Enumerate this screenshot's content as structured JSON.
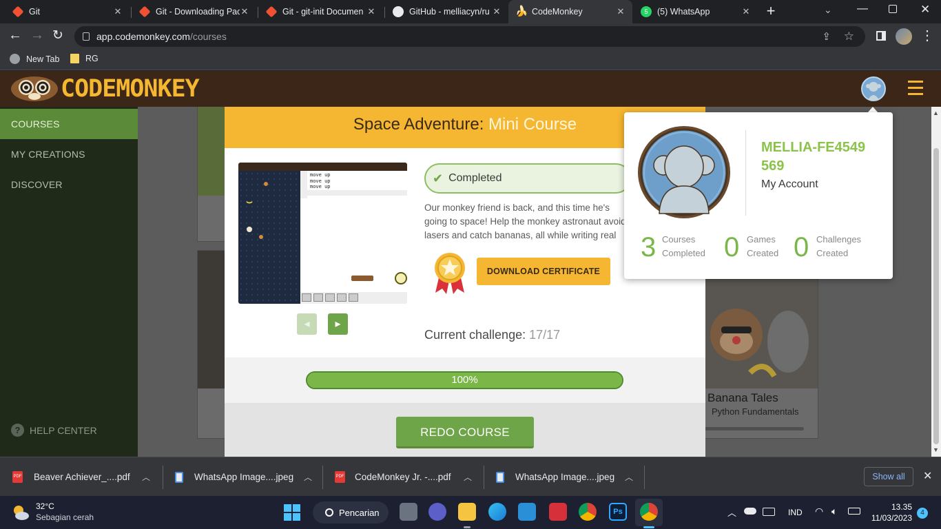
{
  "browser": {
    "tabs": [
      {
        "title": "Git",
        "active": false
      },
      {
        "title": "Git - Downloading Pac",
        "active": false
      },
      {
        "title": "Git - git-init Documen",
        "active": false
      },
      {
        "title": "GitHub - melliacyn/ru",
        "active": false
      },
      {
        "title": "CodeMonkey",
        "active": true
      },
      {
        "title": "(5) WhatsApp",
        "active": false
      }
    ],
    "whatsapp_badge": "5",
    "url_domain": "app.codemonkey.com",
    "url_path": "/courses",
    "bookmarks": [
      {
        "label": "New Tab"
      },
      {
        "label": "RG"
      }
    ]
  },
  "app": {
    "logo_text": "CODEMONKEY",
    "sidebar": {
      "items": [
        {
          "label": "COURSES",
          "active": true
        },
        {
          "label": "MY CREATIONS",
          "active": false
        },
        {
          "label": "DISCOVER",
          "active": false
        }
      ],
      "help_label": "HELP CENTER"
    },
    "background_card": {
      "title": "Banana Tales",
      "subtitle": "Python Fundamentals"
    }
  },
  "modal": {
    "title_main": "Space Adventure:",
    "title_sub": " Mini Course",
    "status": "Completed",
    "description": "Our monkey friend is back, and this time he's going to space! Help the monkey astronaut avoid lasers and catch bananas, all while writing real code, in this activity.",
    "code_lines": [
      "move up",
      "move up",
      "move up",
      ""
    ],
    "download_label": "DOWNLOAD CERTIFICATE",
    "current_challenge_label": "Current challenge:",
    "current_challenge_value": "17/17",
    "progress_label": "100%",
    "progress_value": 1.0,
    "redo_label": "REDO COURSE"
  },
  "profile_popup": {
    "username": "MELLIA-FE4549569",
    "account_label": "My Account",
    "stats": [
      {
        "value": "3",
        "label_line1": "Courses",
        "label_line2": "Completed"
      },
      {
        "value": "0",
        "label_line1": "Games",
        "label_line2": "Created"
      },
      {
        "value": "0",
        "label_line1": "Challenges",
        "label_line2": "Created"
      }
    ]
  },
  "downloads": {
    "items": [
      {
        "name": "Beaver Achiever_....pdf",
        "type": "pdf"
      },
      {
        "name": "WhatsApp Image....jpeg",
        "type": "image"
      },
      {
        "name": "CodeMonkey Jr. -....pdf",
        "type": "pdf"
      },
      {
        "name": "WhatsApp Image....jpeg",
        "type": "image"
      }
    ],
    "show_all_label": "Show all"
  },
  "taskbar": {
    "weather_temp": "32°C",
    "weather_desc": "Sebagian cerah",
    "search_label": "Pencarian",
    "language": "IND",
    "time": "13.35",
    "date": "11/03/2023",
    "notification_count": "4"
  },
  "colors": {
    "accent_green": "#6ea548",
    "header_brown": "#3b2617",
    "modal_yellow": "#f5b731"
  }
}
